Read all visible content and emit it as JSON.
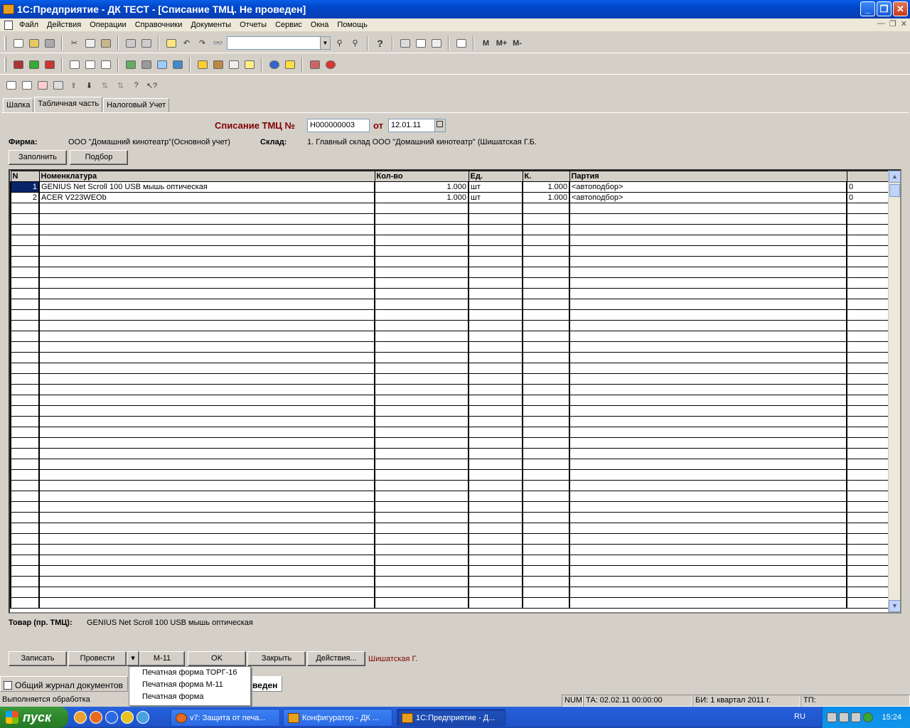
{
  "window": {
    "title": "1С:Предприятие - ДК ТЕСТ - [Списание ТМЦ. Не проведен]"
  },
  "menu": [
    "Файл",
    "Действия",
    "Операции",
    "Справочники",
    "Документы",
    "Отчеты",
    "Сервис",
    "Окна",
    "Помощь"
  ],
  "toolbar3": {
    "m": "M",
    "mplus": "M+",
    "mminus": "M-"
  },
  "tabs": [
    "Шапка",
    "Табличная часть",
    "Налоговый Учет"
  ],
  "document": {
    "title": "Списание ТМЦ №",
    "number": "Н000000003",
    "from_label": "от",
    "date": "12.01.11",
    "firm_label": "Фирма:",
    "firm_value": "ООО \"Домашний кинотеатр\"(Основной учет)",
    "warehouse_label": "Склад:",
    "warehouse_value": "1. Главный склад ООО \"Домашний кинотеатр\" (Шишатская Г.Б.",
    "fill_button": "Заполнить",
    "select_button": "Подбор"
  },
  "table": {
    "columns": [
      "N",
      "Номенклатура",
      "Кол-во",
      "Ед.",
      "К.",
      "Партия",
      ""
    ],
    "rows": [
      {
        "n": "1",
        "name": "GENIUS Net Scroll 100 USB мышь оптическая",
        "qty": "1.000",
        "unit": "шт",
        "k": "1.000",
        "batch": "<автоподбор>",
        "extra": "0"
      },
      {
        "n": "2",
        "name": "ACER V223WEOb",
        "qty": "1.000",
        "unit": "шт",
        "k": "1.000",
        "batch": "<автоподбор>",
        "extra": "0"
      }
    ]
  },
  "goods_label": "Товар (пр. ТМЦ):",
  "goods_value": "GENIUS Net Scroll 100 USB мышь оптическая",
  "buttons": {
    "save": "Записать",
    "post": "Провести",
    "m11": "М-11",
    "ok": "OK",
    "close": "Закрыть",
    "actions": "Действия...",
    "user": "Шишатская Г."
  },
  "print_menu": [
    "Печатная форма ТОРГ-16",
    "Печатная форма М-11",
    "Печатная форма"
  ],
  "window_tabs": {
    "journal": "Общий журнал документов",
    "current": "проведен"
  },
  "status": {
    "msg": "Выполняется обработка",
    "num": "NUM",
    "ta": "ТА: 02.02.11  00:00:00",
    "bi": "БИ: 1 квартал 2011 г.",
    "tp": "ТП:"
  },
  "taskbar": {
    "start": "пуск",
    "items": [
      "v7: Защита от печа...",
      "Конфигуратор - ДК ...",
      "1С:Предприятие - Д..."
    ],
    "lang": "RU",
    "time": "15:24"
  }
}
